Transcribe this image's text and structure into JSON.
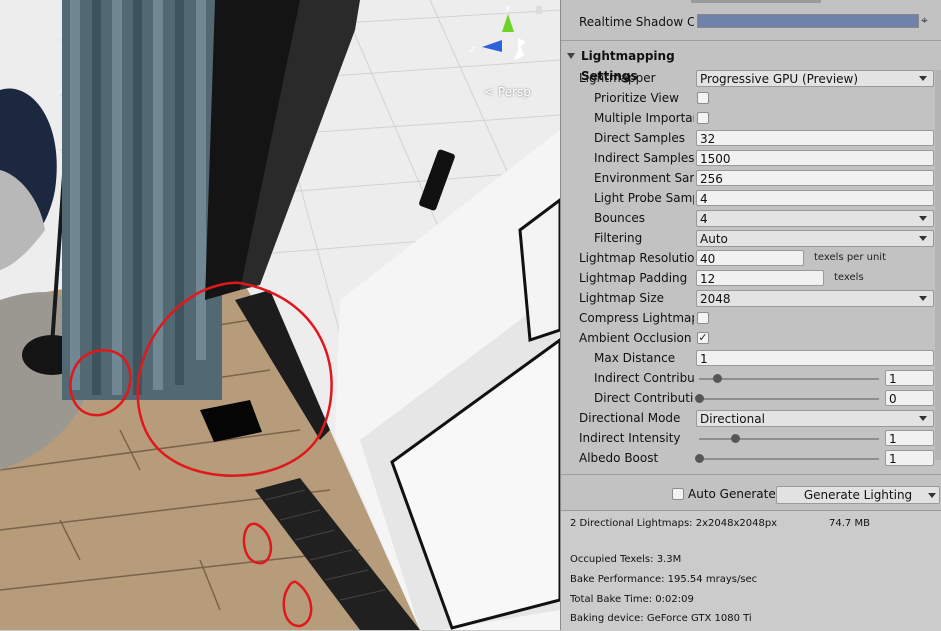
{
  "scene": {
    "view_label": "< Persp",
    "gizmo_axes": {
      "y": "y",
      "z": "z"
    }
  },
  "panel": {
    "realtime_shadow_label": "Realtime Shadow Co",
    "header_title": "Lightmapping Settings",
    "rows": {
      "lightmapper": {
        "label": "Lightmapper",
        "value": "Progressive GPU (Preview)"
      },
      "prioritize_view": {
        "label": "Prioritize View",
        "checked": false
      },
      "multiple_importance": {
        "label": "Multiple Importance",
        "checked": false
      },
      "direct_samples": {
        "label": "Direct Samples",
        "value": "32"
      },
      "indirect_samples": {
        "label": "Indirect Samples",
        "value": "1500"
      },
      "environment_samples": {
        "label": "Environment Samples",
        "value": "256"
      },
      "light_probe_samples": {
        "label": "Light Probe Samples",
        "value": "4"
      },
      "bounces": {
        "label": "Bounces",
        "value": "4"
      },
      "filtering": {
        "label": "Filtering",
        "value": "Auto"
      },
      "lightmap_resolution": {
        "label": "Lightmap Resolution",
        "value": "40",
        "unit": "texels per unit"
      },
      "lightmap_padding": {
        "label": "Lightmap Padding",
        "value": "12",
        "unit": "texels"
      },
      "lightmap_size": {
        "label": "Lightmap Size",
        "value": "2048"
      },
      "compress_lightmaps": {
        "label": "Compress Lightmaps",
        "checked": false
      },
      "ambient_occlusion": {
        "label": "Ambient Occlusion",
        "checked": true,
        "check_glyph": "✓"
      },
      "max_distance": {
        "label": "Max Distance",
        "value": "1"
      },
      "indirect_contribution": {
        "label": "Indirect Contribution",
        "value": "1",
        "fraction": 0.1
      },
      "direct_contribution": {
        "label": "Direct Contribution",
        "value": "0",
        "fraction": 0.0
      },
      "directional_mode": {
        "label": "Directional Mode",
        "value": "Directional"
      },
      "indirect_intensity": {
        "label": "Indirect Intensity",
        "value": "1",
        "fraction": 0.2
      },
      "albedo_boost": {
        "label": "Albedo Boost",
        "value": "1",
        "fraction": 0.0
      }
    },
    "auto_generate": {
      "label": "Auto Generate",
      "checked": false
    },
    "generate_button": "Generate Lighting",
    "stats": {
      "lightmaps": "2 Directional Lightmaps: 2x2048x2048px",
      "size": "74.7 MB",
      "occupied": "Occupied Texels: 3.3M",
      "performance": "Bake Performance: 195.54 mrays/sec",
      "bake_time": "Total Bake Time: 0:02:09",
      "device": "Baking device: GeForce GTX 1080 Ti"
    }
  },
  "colors": {
    "panel_bg": "#c2c2c2",
    "shadow_color_swatch": "#6f82a8",
    "annotation_red": "#e0181c"
  }
}
